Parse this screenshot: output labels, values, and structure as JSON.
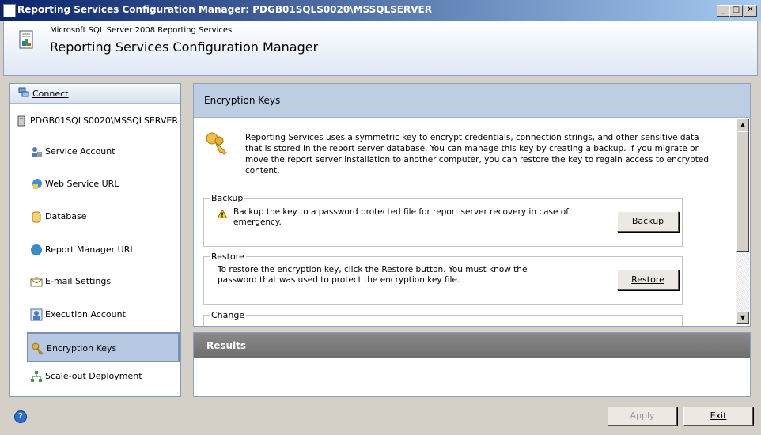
{
  "window": {
    "title": "Reporting Services Configuration Manager: PDGB01SQLS0020\\MSSQLSERVER",
    "minimize": "_",
    "maximize": "□",
    "close": "✕"
  },
  "header": {
    "product": "Microsoft SQL Server 2008 Reporting Services",
    "title": "Reporting Services Configuration Manager"
  },
  "nav": {
    "connect_label": "Connect",
    "server": "PDGB01SQLS0020\\MSSQLSERVER",
    "items": [
      {
        "label": "Service Account",
        "icon": "service-account-icon"
      },
      {
        "label": "Web Service URL",
        "icon": "web-service-icon"
      },
      {
        "label": "Database",
        "icon": "database-icon"
      },
      {
        "label": "Report Manager URL",
        "icon": "globe-icon"
      },
      {
        "label": "E-mail Settings",
        "icon": "email-icon"
      },
      {
        "label": "Execution Account",
        "icon": "execution-account-icon"
      },
      {
        "label": "Encryption Keys",
        "icon": "key-icon",
        "active": true
      },
      {
        "label": "Scale-out Deployment",
        "icon": "scale-out-icon"
      }
    ]
  },
  "main": {
    "title": "Encryption Keys",
    "description": "Reporting Services uses a symmetric key to encrypt credentials, connection strings, and other sensitive data that is stored in the report server database.  You can manage this key by creating a backup.  If you migrate or move the report server installation to another computer, you can restore the key to regain access to encrypted content.",
    "backup": {
      "legend": "Backup",
      "text": "Backup the key to a password protected file for report server recovery in case of emergency.",
      "button": "Backup"
    },
    "restore": {
      "legend": "Restore",
      "text": "To restore the encryption key, click the Restore button.  You must know the password that was used to protect the encryption key file.",
      "button": "Restore"
    },
    "change": {
      "legend": "Change"
    }
  },
  "results": {
    "title": "Results"
  },
  "footer": {
    "help": "?",
    "apply": "Apply",
    "exit": "Exit"
  },
  "colors": {
    "titlebar": "#0a246a",
    "panel_header": "#bdcde2",
    "results_header": "#7a7a7a",
    "active_nav": "#b7c8e3"
  }
}
